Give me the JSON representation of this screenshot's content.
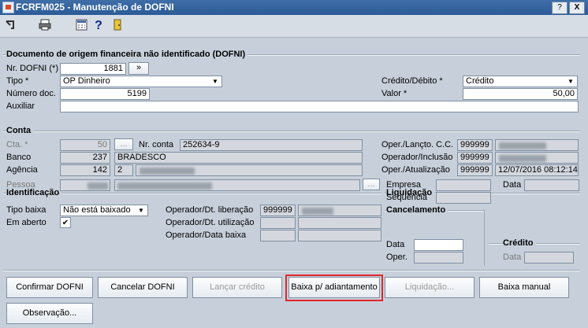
{
  "window": {
    "title": "FCRFM025 - Manutenção de DOFNI",
    "help_btn": "?",
    "close_btn": "X"
  },
  "toolbar": {
    "icons": [
      "exit-icon",
      "print-icon",
      "calculator-icon",
      "help-icon",
      "door-icon"
    ],
    "help_glyph": "?"
  },
  "doc": {
    "title": "Documento de origem financeira não identificado (DOFNI)",
    "nr_label": "Nr. DOFNI (*)",
    "nr_value": "1881",
    "nr_btn": "»",
    "tipo_label": "Tipo *",
    "tipo_value": "OP Dinheiro",
    "numero_label": "Número doc.",
    "numero_value": "5199",
    "auxiliar_label": "Auxiliar",
    "auxiliar_value": "",
    "cd_label": "Crédito/Débito *",
    "cd_value": "Crédito",
    "valor_label": "Valor *",
    "valor_value": "50,00"
  },
  "conta": {
    "title": "Conta",
    "cta_label": "Cta. *",
    "cta_value": "50",
    "cta_btn": "...",
    "nr_conta_label": "Nr. conta",
    "nr_conta_value": "252634-9",
    "banco_label": "Banco",
    "banco_code": "237",
    "banco_name": "BRADESCO",
    "agencia_label": "Agência",
    "agencia_code": "142",
    "agencia_dv": "2",
    "oper_lancto_label": "Oper./Lançto. C.C.",
    "oper_lancto_value": "999999",
    "oper_inclusao_label": "Operador/Inclusão",
    "oper_inclusao_value": "999999",
    "oper_atual_label": "Oper./Atualização",
    "oper_atual_value": "999999",
    "oper_atual_date": "12/07/2016 08:12:14"
  },
  "ident": {
    "title": "Identificação",
    "pessoa_label": "Pessoa",
    "pessoa_btn": "...",
    "tipo_baixa_label": "Tipo baixa",
    "tipo_baixa_value": "Não está baixado",
    "em_aberto_label": "Em aberto",
    "em_aberto_check": "✔",
    "op_lib_label": "Operador/Dt. liberação",
    "op_lib_value": "999999",
    "op_util_label": "Operador/Dt. utilização",
    "op_baixa_label": "Operador/Data baixa"
  },
  "liquidacao": {
    "title": "Liquidação",
    "empresa_label": "Empresa",
    "data_label": "Data",
    "sequencia_label": "Sequência"
  },
  "cancelamento": {
    "title": "Cancelamento",
    "data_label": "Data",
    "oper_label": "Oper."
  },
  "credito": {
    "title": "Crédito",
    "data_label": "Data"
  },
  "buttons": {
    "confirmar": "Confirmar DOFNI",
    "cancelar": "Cancelar DOFNI",
    "lancar": "Lançar crédito",
    "baixa_adiant": "Baixa p/ adiantamento",
    "liquidacao": "Liquidação...",
    "baixa_manual": "Baixa manual",
    "observacao": "Observação..."
  },
  "colors": {
    "highlight": "#e2262b",
    "titlebar": "#2b5b97",
    "background": "#c7d0da"
  }
}
